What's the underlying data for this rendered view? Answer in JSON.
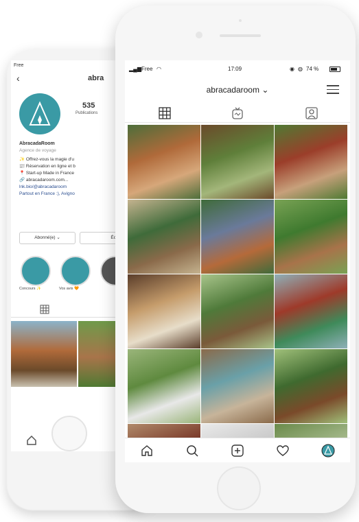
{
  "back_phone": {
    "status_carrier": "Free",
    "username": "abra",
    "posts_count": "535",
    "posts_label": "Publications",
    "display_name": "AbracadaRoom",
    "category": "Agence de voyage",
    "bio_lines": [
      "✨ Offrez-vous la magie d'u",
      "📰 Réservation en ligne et b",
      "📍 Start-up Made in France",
      "🔗 abracadaroom.com..."
    ],
    "link_text": "lnk.bio/@abracadaroom",
    "location_text": "Partout en France :), Avigno",
    "follow_button": "Abonné(e) ⌄",
    "message_button": "Écri",
    "highlights": [
      "Concours ✨",
      "Vos avis 🧡"
    ]
  },
  "front_phone": {
    "status": {
      "carrier": "Free",
      "time": "17:09",
      "battery": "74 %"
    },
    "header": {
      "username": "abracadaroom",
      "dropdown": "⌄"
    },
    "tabs": [
      "grid-tab",
      "igtv-tab",
      "tagged-tab"
    ],
    "grid_tiles": [
      {
        "name": "tile-cabin-terrace",
        "colors": [
          "#b06a3a",
          "#d6a77a",
          "#4d6e3a"
        ]
      },
      {
        "name": "tile-treehouse-forest",
        "colors": [
          "#5f7f3a",
          "#a3b67a",
          "#6b4a2a"
        ]
      },
      {
        "name": "tile-roulotte-stairs",
        "colors": [
          "#9b3e2a",
          "#c7a07b",
          "#4f7a33"
        ]
      },
      {
        "name": "tile-bubble-boardwalk",
        "colors": [
          "#3f6b3a",
          "#8a6a4a",
          "#c5b38f"
        ]
      },
      {
        "name": "tile-bubble-dome",
        "colors": [
          "#6a7a9a",
          "#b56a3a",
          "#3f6b3a"
        ]
      },
      {
        "name": "tile-cabin-green",
        "colors": [
          "#3f7a2f",
          "#a8734a",
          "#79a254"
        ]
      },
      {
        "name": "tile-lodge-deck",
        "colors": [
          "#c59c6b",
          "#e7ddc9",
          "#5a3d2a"
        ]
      },
      {
        "name": "tile-stilt-cabin",
        "colors": [
          "#4f7a3a",
          "#7a5a3a",
          "#a8c48a"
        ]
      },
      {
        "name": "tile-roulotte-lake",
        "colors": [
          "#9e3a2a",
          "#3f8a5a",
          "#8fb0b8"
        ]
      },
      {
        "name": "tile-bubbles-trees",
        "colors": [
          "#5f8a3f",
          "#e8e8e8",
          "#9ab57a"
        ]
      },
      {
        "name": "tile-floating-domes",
        "colors": [
          "#6aa0a8",
          "#c7b49a",
          "#8a6a4a"
        ]
      },
      {
        "name": "tile-treehouse-tall",
        "colors": [
          "#3f6a2f",
          "#7a4a2a",
          "#a0c07a"
        ]
      },
      {
        "name": "tile-cabin-roof",
        "colors": [
          "#7a3a2a",
          "#3f6b3a",
          "#b08a6a"
        ]
      },
      {
        "name": "tile-parasol",
        "colors": [
          "#c9c9c9",
          "#b3a07a",
          "#eaeaea"
        ]
      },
      {
        "name": "tile-trees-sky",
        "colors": [
          "#a4b88a",
          "#d8d8d0",
          "#6a8a4a"
        ]
      }
    ],
    "bottom_nav": [
      "home-icon",
      "search-icon",
      "add-post-icon",
      "heart-icon",
      "profile-avatar-icon"
    ]
  }
}
